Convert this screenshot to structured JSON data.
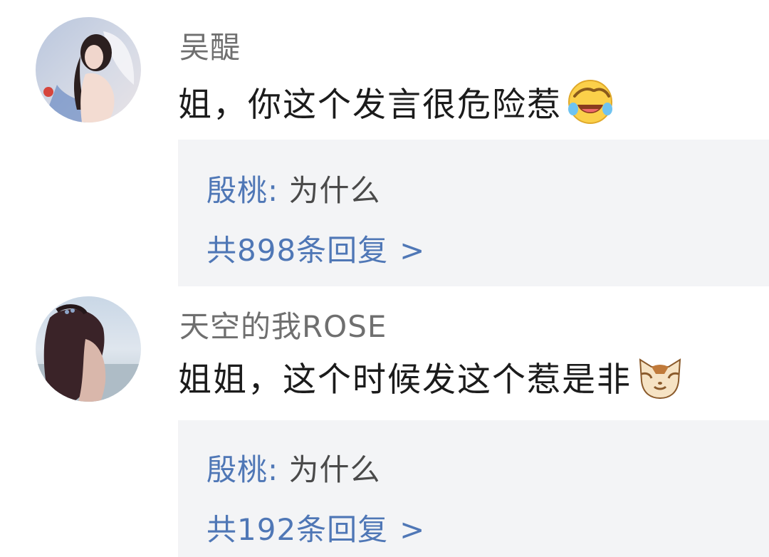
{
  "comments": [
    {
      "username": "吴醍",
      "text": "姐，你这个发言很危险惹",
      "emoji": "laugh-crying-emoji",
      "avatar": "avatar-girl-with-wings",
      "reply": {
        "author": "殷桃",
        "separator": ":",
        "text": "为什么",
        "count_label": "共898条回复",
        "chevron": ">"
      }
    },
    {
      "username": "天空的我ROSE",
      "text": "姐姐，这个时候发这个惹是非",
      "emoji": "cat-face-emoji",
      "avatar": "avatar-girl-back-view",
      "reply": {
        "author": "殷桃",
        "separator": ":",
        "text": "为什么",
        "count_label": "共192条回复",
        "chevron": ">"
      }
    }
  ],
  "colors": {
    "link_blue": "#4f77b6",
    "username_gray": "#6f6f6f",
    "reply_bg": "#f3f4f6",
    "body_text": "#1b1b1b"
  }
}
